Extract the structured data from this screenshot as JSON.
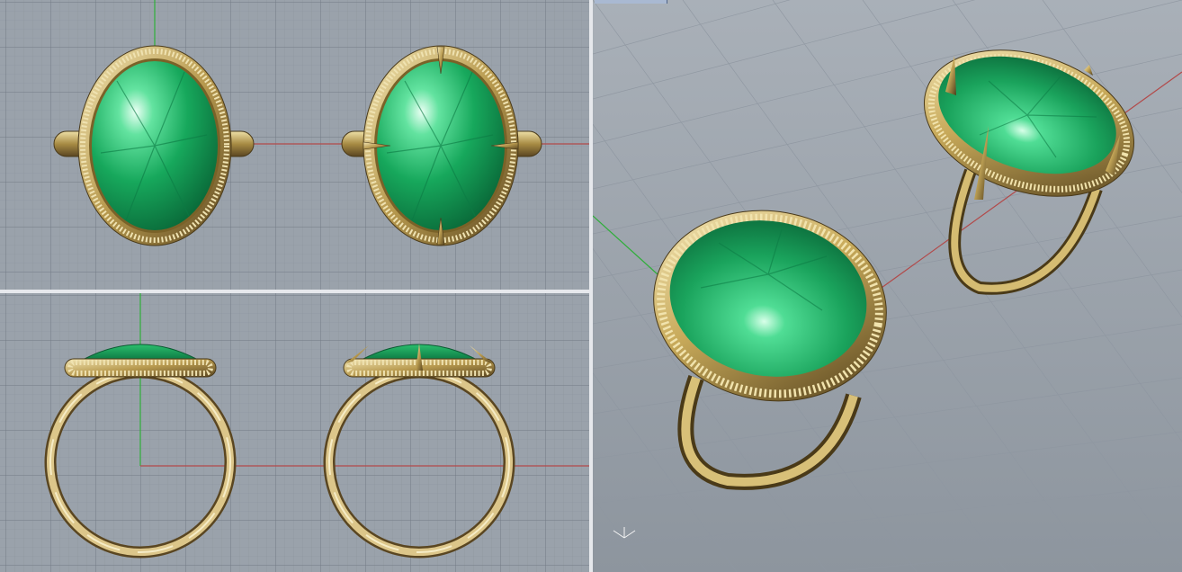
{
  "app": {
    "layout": "three-viewports"
  },
  "viewports": {
    "top": {
      "name": "",
      "grid": true,
      "objects": [
        "emerald-halo-ring",
        "emerald-halo-ring-with-prongs"
      ]
    },
    "front": {
      "name": "",
      "grid": true,
      "objects": [
        "emerald-ring-profile",
        "emerald-ring-profile-with-prongs"
      ]
    },
    "perspective": {
      "name": "",
      "grid": true,
      "objects": [
        "emerald-ring-rendered",
        "emerald-ring-rendered-with-prongs"
      ]
    }
  },
  "colors": {
    "viewport_bg": "#9aa2ab",
    "grid_minor": "#8a929c",
    "grid_major": "#6f7782",
    "x_axis": "#b04545",
    "y_axis": "#3ca03c",
    "gold": "#c9b06a",
    "emerald": "#1fa060"
  },
  "icons": {
    "world_axes": "axes-widget-icon"
  }
}
